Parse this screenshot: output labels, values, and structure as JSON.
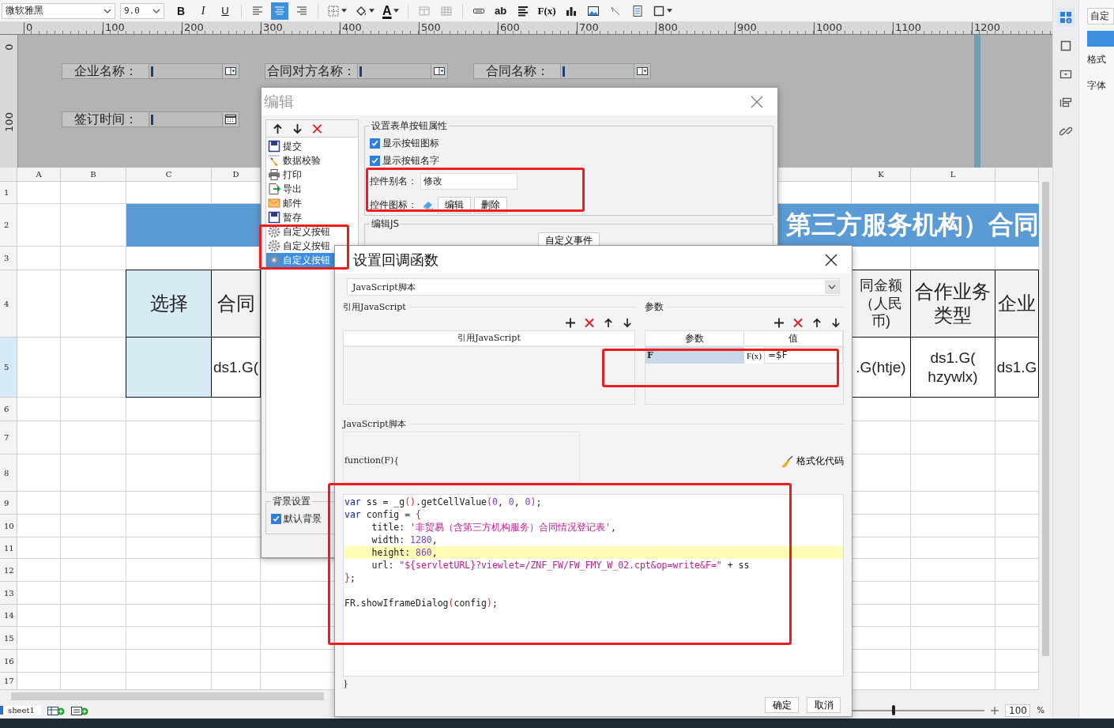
{
  "toolbar": {
    "font": "微软雅黑",
    "size": "9.0",
    "buttons": [
      {
        "kind": "bold",
        "label": "B"
      },
      {
        "kind": "italic",
        "label": "I"
      },
      {
        "kind": "underline",
        "label": "U"
      },
      {
        "kind": "separator"
      },
      {
        "kind": "align-left",
        "selected": false
      },
      {
        "kind": "align-center",
        "selected": true
      },
      {
        "kind": "align-right",
        "selected": false
      },
      {
        "kind": "separator"
      },
      {
        "kind": "border",
        "dropdown": true
      },
      {
        "kind": "fill",
        "dropdown": true
      },
      {
        "kind": "font-color",
        "label": "A",
        "dropdown": true
      },
      {
        "kind": "separator"
      },
      {
        "kind": "merge"
      },
      {
        "kind": "grid"
      },
      {
        "kind": "separator"
      },
      {
        "kind": "field"
      },
      {
        "kind": "text",
        "label": "ab"
      },
      {
        "kind": "lines"
      },
      {
        "kind": "formula",
        "label": "F(x)"
      },
      {
        "kind": "chart"
      },
      {
        "kind": "image"
      },
      {
        "kind": "slash"
      },
      {
        "kind": "form"
      },
      {
        "kind": "frame",
        "dropdown": true
      }
    ]
  },
  "ruler": {
    "marks": [
      "0",
      "100",
      "200",
      "300",
      "400",
      "500",
      "600",
      "700",
      "800",
      "900",
      "1000",
      "1100",
      "1200"
    ],
    "vertical_marks": [
      "0",
      "100"
    ]
  },
  "form_widgets": [
    [
      {
        "label": "企业名称：",
        "kind": "combo"
      },
      {
        "label": "合同对方名称：",
        "kind": "combo"
      },
      {
        "label": "合同名称：",
        "kind": "combo"
      }
    ],
    [
      {
        "label": "签订时间：",
        "kind": "date"
      }
    ]
  ],
  "sheet": {
    "columns": [
      "A",
      "B",
      "C",
      "D",
      "K",
      "L"
    ],
    "rows": [
      {
        "label": "1",
        "selected": false
      },
      {
        "label": "2",
        "selected": false
      },
      {
        "label": "3",
        "selected": false
      },
      {
        "label": "4",
        "selected": false
      },
      {
        "label": "5",
        "selected": true
      },
      {
        "label": "6",
        "selected": false
      },
      {
        "label": "7",
        "selected": false
      },
      {
        "label": "8",
        "selected": false
      },
      {
        "label": "9",
        "selected": false
      },
      {
        "label": "10",
        "selected": false
      },
      {
        "label": "11",
        "selected": false
      },
      {
        "label": "12",
        "selected": false
      },
      {
        "label": "13",
        "selected": false
      },
      {
        "label": "14",
        "selected": false
      },
      {
        "label": "15",
        "selected": false
      },
      {
        "label": "16",
        "selected": false
      },
      {
        "label": "17",
        "selected": false
      }
    ],
    "banner": "第三方服务机构）合同",
    "header_cells": {
      "C": "选择",
      "D": "合同",
      "K": "同金额（人民币)",
      "L": "合作业务类型",
      "M": "企业"
    },
    "data_cells": {
      "D": "ds1.G(",
      "K": ".G(htje)",
      "L": "ds1.G(\nhzywlx)",
      "M": "ds1.G"
    }
  },
  "bottom_bar": {
    "sheet_tabs": [
      {
        "label": "sheet1",
        "selected": true
      }
    ],
    "zoom": {
      "level": 0.5,
      "value": "100",
      "unit": "%"
    }
  },
  "right_panel": {
    "tools": [
      {
        "kind": "cell",
        "selected": true
      },
      {
        "kind": "square",
        "selected": false
      },
      {
        "kind": "dropdown",
        "selected": false
      },
      {
        "kind": "layers",
        "selected": false
      },
      {
        "kind": "link",
        "selected": false
      }
    ],
    "field_value": "自定",
    "format_label": "格式",
    "font_label": "字体"
  },
  "edit_dialog": {
    "title": "编辑",
    "items": [
      {
        "label": "提交",
        "kind": "save",
        "selected": false
      },
      {
        "label": "数据校验",
        "kind": "check",
        "selected": false
      },
      {
        "label": "打印",
        "kind": "print",
        "selected": false
      },
      {
        "label": "导出",
        "kind": "export",
        "selected": false
      },
      {
        "label": "邮件",
        "kind": "mail",
        "selected": false
      },
      {
        "label": "暂存",
        "kind": "save",
        "selected": false
      },
      {
        "label": "自定义按钮",
        "kind": "custom",
        "selected": false
      },
      {
        "label": "自定义按钮",
        "kind": "custom",
        "selected": false
      },
      {
        "label": "自定义按钮",
        "kind": "custom",
        "selected": true
      }
    ],
    "props_title": "设置表单按钮属性",
    "show_icon": {
      "label": "显示按钮图标",
      "checked": true
    },
    "show_name": {
      "label": "显示按钮名字",
      "checked": true
    },
    "alias_label": "控件别名：",
    "alias_value": "修改",
    "icon_label": "控件图标：",
    "icon_buttons": [
      "编辑",
      "删除"
    ],
    "js_title": "编辑JS",
    "custom_event": "自定义事件",
    "bg_title": "背景设置",
    "default_bg": {
      "label": "默认背景",
      "checked": true
    }
  },
  "callback_dialog": {
    "title": "设置回调函数",
    "script_type": "JavaScript脚本",
    "ref_title": "引用JavaScript",
    "ref_column": "引用JavaScript",
    "params_title": "参数",
    "param_columns": [
      "参数",
      "值"
    ],
    "params": [
      {
        "name": "F",
        "formula_label": "F(x)",
        "value": "=$F",
        "selected": true
      }
    ],
    "script_title": "JavaScript脚本",
    "function_head": "function(F){",
    "format_code": "格式化代码",
    "code_lines": [
      {
        "highlighted": false,
        "blank_after": false,
        "tokens": [
          {
            "kind": "keyword",
            "text": "var"
          },
          {
            "kind": "plain",
            "text": " ss = _g"
          },
          {
            "kind": "bracket",
            "text": "()"
          },
          {
            "kind": "plain",
            "text": ".getCellValue"
          },
          {
            "kind": "bracket",
            "text": "("
          },
          {
            "kind": "number",
            "text": "0"
          },
          {
            "kind": "plain",
            "text": ", "
          },
          {
            "kind": "number",
            "text": "0"
          },
          {
            "kind": "plain",
            "text": ", "
          },
          {
            "kind": "number",
            "text": "0"
          },
          {
            "kind": "bracket",
            "text": ")"
          },
          {
            "kind": "plain",
            "text": ";"
          }
        ]
      },
      {
        "highlighted": false,
        "blank_after": false,
        "tokens": [
          {
            "kind": "keyword",
            "text": "var"
          },
          {
            "kind": "plain",
            "text": " config = "
          },
          {
            "kind": "bracket",
            "text": "{"
          }
        ]
      },
      {
        "highlighted": false,
        "blank_after": false,
        "tokens": [
          {
            "kind": "plain",
            "text": "     title: "
          },
          {
            "kind": "string",
            "text": "'非贸易（含第三方机构服务）合同情况登记表'"
          },
          {
            "kind": "plain",
            "text": ","
          }
        ]
      },
      {
        "highlighted": false,
        "blank_after": false,
        "tokens": [
          {
            "kind": "plain",
            "text": "     width: "
          },
          {
            "kind": "number",
            "text": "1280"
          },
          {
            "kind": "plain",
            "text": ","
          }
        ]
      },
      {
        "highlighted": true,
        "blank_after": false,
        "tokens": [
          {
            "kind": "plain",
            "text": "     height: "
          },
          {
            "kind": "number",
            "text": "860"
          },
          {
            "kind": "plain",
            "text": ","
          }
        ]
      },
      {
        "highlighted": false,
        "blank_after": false,
        "tokens": [
          {
            "kind": "plain",
            "text": "     url: "
          },
          {
            "kind": "string",
            "text": "\"${servletURL}?viewlet=/ZNF_FW/FW_FMY_W_02.cpt&op=write&F=\""
          },
          {
            "kind": "plain",
            "text": " + ss"
          }
        ]
      },
      {
        "highlighted": false,
        "blank_after": true,
        "tokens": [
          {
            "kind": "bracket",
            "text": "}"
          },
          {
            "kind": "plain",
            "text": ";"
          }
        ]
      },
      {
        "highlighted": false,
        "blank_after": false,
        "tokens": [
          {
            "kind": "plain",
            "text": "FR.showIframeDialog"
          },
          {
            "kind": "bracket",
            "text": "("
          },
          {
            "kind": "plain",
            "text": "config"
          },
          {
            "kind": "bracket",
            "text": ")"
          },
          {
            "kind": "plain",
            "text": ";"
          }
        ]
      }
    ],
    "closing": "}",
    "buttons": [
      "确定",
      "取消"
    ]
  }
}
